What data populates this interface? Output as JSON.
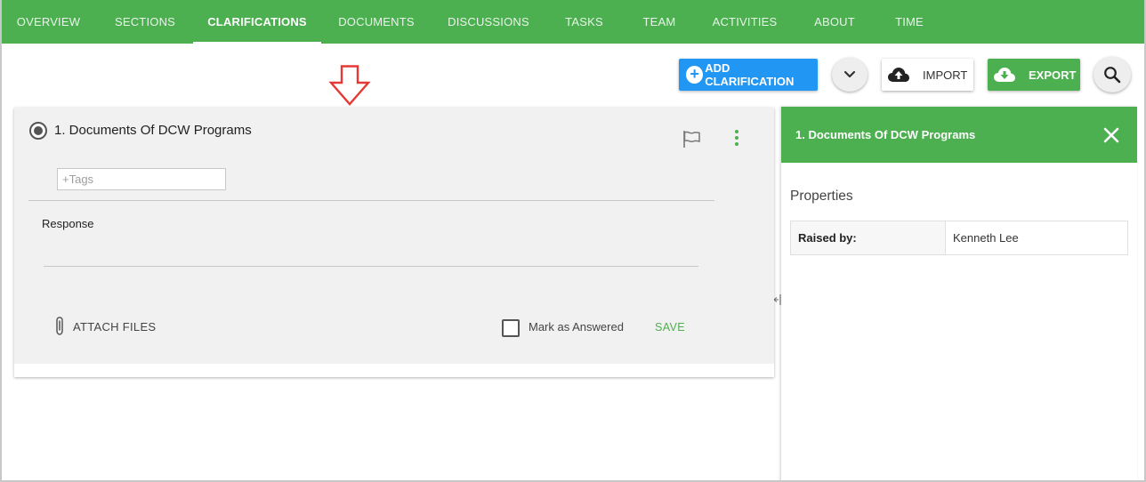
{
  "nav": {
    "tabs": [
      {
        "label": "OVERVIEW"
      },
      {
        "label": "SECTIONS"
      },
      {
        "label": "CLARIFICATIONS",
        "active": true
      },
      {
        "label": "DOCUMENTS"
      },
      {
        "label": "DISCUSSIONS"
      },
      {
        "label": "TASKS"
      },
      {
        "label": "TEAM"
      },
      {
        "label": "ACTIVITIES"
      },
      {
        "label": "ABOUT"
      },
      {
        "label": "TIME"
      }
    ]
  },
  "toolbar": {
    "add_label": "ADD CLARIFICATION",
    "import_label": "IMPORT",
    "export_label": "EXPORT",
    "icons": {
      "add": "plus-circle-icon",
      "dropdown": "chevron-down-icon",
      "import": "cloud-upload-icon",
      "export": "cloud-download-icon",
      "search": "search-icon"
    }
  },
  "annotation": {
    "icon": "red-down-arrow-icon",
    "color": "#e53935"
  },
  "clarification": {
    "title": "1. Documents Of DCW Programs",
    "tags_placeholder": "+Tags",
    "response_label": "Response",
    "attach_label": "ATTACH FILES",
    "mark_answered_label": "Mark as Answered",
    "save_label": "SAVE",
    "icons": {
      "flag": "flag-icon",
      "menu": "kebab-menu-icon",
      "attach": "paperclip-icon"
    }
  },
  "panel": {
    "title": "1. Documents Of DCW Programs",
    "properties_heading": "Properties",
    "properties": [
      {
        "key": "Raised by:",
        "value": "Kenneth Lee"
      }
    ]
  },
  "colors": {
    "brand_green": "#4caf50",
    "primary_blue": "#2196f3",
    "card_bg": "#f1f1f1"
  }
}
